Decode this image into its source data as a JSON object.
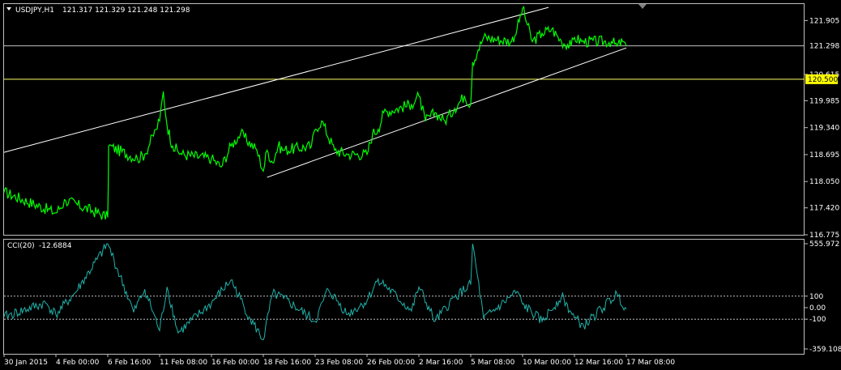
{
  "chart_data": [
    {
      "type": "line",
      "title": "USDJPY,H1",
      "ohlc": {
        "open": 121.317,
        "high": 121.329,
        "low": 121.248,
        "close": 121.298
      },
      "ohlc_text": "121.317 121.329 121.248 121.298",
      "ylim": [
        116.775,
        122.3
      ],
      "yticks": [
        "121.905",
        "120.615",
        "119.985",
        "119.340",
        "118.695",
        "118.050",
        "117.420",
        "116.775"
      ],
      "last_price": "121.298",
      "level_price": "120.500",
      "level_price_value": 120.5,
      "last_price_value": 121.298,
      "x_tick_labels": [
        "30 Jan 2015",
        "4 Feb 00:00",
        "6 Feb 16:00",
        "11 Feb 08:00",
        "16 Feb 00:00",
        "18 Feb 16:00",
        "23 Feb 08:00",
        "26 Feb 00:00",
        "2 Mar 16:00",
        "5 Mar 08:00",
        "10 Mar 00:00",
        "12 Mar 16:00",
        "17 Mar 08:00"
      ],
      "series": [
        {
          "color": "#00ff00",
          "x": [
            "30 Jan 2015",
            "4 Feb 00:00",
            "4 Feb 12:00",
            "6 Feb 16:00",
            "6 Feb 18:00",
            "9 Feb 08:00",
            "10 Feb 00:00",
            "11 Feb 00:00",
            "11 Feb 08:00",
            "11 Feb 16:00",
            "12 Feb 00:00",
            "12 Feb 12:00",
            "13 Feb 08:00",
            "16 Feb 00:00",
            "16 Feb 12:00",
            "17 Feb 00:00",
            "17 Feb 12:00",
            "18 Feb 08:00",
            "18 Feb 16:00",
            "19 Feb 00:00",
            "19 Feb 12:00",
            "20 Feb 00:00",
            "20 Feb 12:00",
            "23 Feb 00:00",
            "23 Feb 08:00",
            "23 Feb 16:00",
            "24 Feb 08:00",
            "25 Feb 00:00",
            "26 Feb 00:00",
            "26 Feb 12:00",
            "27 Feb 00:00",
            "27 Feb 12:00",
            "2 Mar 00:00",
            "2 Mar 16:00",
            "3 Mar 00:00",
            "3 Mar 12:00",
            "4 Mar 00:00",
            "4 Mar 12:00",
            "5 Mar 00:00",
            "5 Mar 08:00",
            "5 Mar 12:00",
            "6 Mar 00:00",
            "6 Mar 12:00",
            "9 Mar 00:00",
            "9 Mar 12:00",
            "10 Mar 00:00",
            "10 Mar 12:00",
            "11 Mar 00:00",
            "11 Mar 12:00",
            "12 Mar 00:00",
            "12 Mar 12:00",
            "12 Mar 16:00",
            "13 Mar 08:00",
            "16 Mar 00:00",
            "16 Mar 12:00",
            "17 Mar 00:00",
            "17 Mar 08:00"
          ],
          "values": [
            117.8,
            117.3,
            117.6,
            117.2,
            118.9,
            118.6,
            118.7,
            119.3,
            119.5,
            120.2,
            119.4,
            118.9,
            118.7,
            118.6,
            118.4,
            118.9,
            119.2,
            118.8,
            118.3,
            118.8,
            118.5,
            118.9,
            118.8,
            118.9,
            119.3,
            119.5,
            118.8,
            118.7,
            118.7,
            119.2,
            119.3,
            119.7,
            119.9,
            120.1,
            119.5,
            119.7,
            119.5,
            119.8,
            120.1,
            119.9,
            120.9,
            121.2,
            121.5,
            121.4,
            121.7,
            122.2,
            121.4,
            121.6,
            121.7,
            121.4,
            121.3,
            121.5,
            121.4,
            121.4,
            121.3,
            121.4,
            121.3
          ]
        }
      ],
      "trendlines": [
        {
          "x": [
            "30 Jan 2015",
            "11 Mar 08:00"
          ],
          "y": [
            118.75,
            122.22
          ]
        },
        {
          "x": [
            "19 Feb 00:00",
            "17 Mar 08:00"
          ],
          "y": [
            118.15,
            121.25
          ]
        }
      ]
    },
    {
      "type": "line",
      "title": "CCI(20)",
      "value_text": "-12.6884",
      "ylim": [
        -359.1081,
        555.972
      ],
      "ytick_labels": [
        "555.972",
        "100",
        "0.00",
        "-100",
        "-359.1081"
      ],
      "levels": [
        100,
        -100
      ],
      "series": [
        {
          "color": "#20b2aa",
          "x": [
            "30 Jan 2015",
            "3 Feb 00:00",
            "4 Feb 00:00",
            "5 Feb 00:00",
            "6 Feb 16:00",
            "9 Feb 00:00",
            "10 Feb 00:00",
            "11 Feb 08:00",
            "12 Feb 00:00",
            "13 Feb 00:00",
            "16 Feb 00:00",
            "17 Feb 00:00",
            "18 Feb 00:00",
            "18 Feb 16:00",
            "19 Feb 12:00",
            "20 Feb 12:00",
            "23 Feb 08:00",
            "24 Feb 00:00",
            "25 Feb 00:00",
            "26 Feb 00:00",
            "27 Feb 00:00",
            "2 Mar 00:00",
            "2 Mar 16:00",
            "3 Mar 12:00",
            "4 Mar 12:00",
            "5 Mar 08:00",
            "5 Mar 12:00",
            "6 Mar 12:00",
            "9 Mar 12:00",
            "10 Mar 00:00",
            "11 Mar 00:00",
            "12 Mar 00:00",
            "12 Mar 16:00",
            "13 Mar 12:00",
            "16 Mar 12:00",
            "17 Mar 08:00"
          ],
          "values": [
            -80,
            40,
            -60,
            130,
            555,
            -40,
            160,
            -200,
            180,
            -220,
            40,
            240,
            -100,
            -280,
            120,
            80,
            -120,
            160,
            -60,
            60,
            250,
            -30,
            180,
            -120,
            90,
            200,
            555,
            -100,
            140,
            30,
            -120,
            100,
            -90,
            -160,
            120,
            -12.7
          ]
        }
      ]
    }
  ]
}
